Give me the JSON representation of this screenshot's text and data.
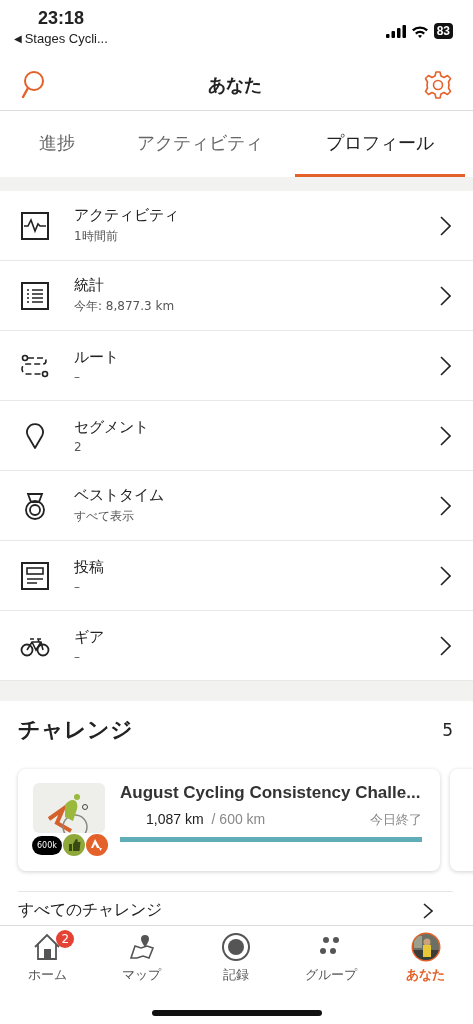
{
  "status_bar": {
    "time": "23:18",
    "back_arrow": "◀",
    "back_label": "Stages Cycli...",
    "battery": "83"
  },
  "header": {
    "title": "あなた"
  },
  "tabs": [
    {
      "label": "進捗",
      "selected": false
    },
    {
      "label": "アクティビティ",
      "selected": false
    },
    {
      "label": "プロフィール",
      "selected": true
    }
  ],
  "menu": [
    {
      "title": "アクティビティ",
      "subtitle": "1時間前"
    },
    {
      "title": "統計",
      "subtitle": "今年: 8,877.3 km"
    },
    {
      "title": "ルート",
      "subtitle": "–"
    },
    {
      "title": "セグメント",
      "subtitle": "2"
    },
    {
      "title": "ベストタイム",
      "subtitle": "すべて表示"
    },
    {
      "title": "投稿",
      "subtitle": "–"
    },
    {
      "title": "ギア",
      "subtitle": "–"
    }
  ],
  "challenges": {
    "title": "チャレンジ",
    "count": "5",
    "cards": [
      {
        "title": "August Cycling Consistency Challe...",
        "badge": "600k",
        "progress": "1,087 km",
        "goal": "/ 600 km",
        "status": "今日終了",
        "level": 1
      }
    ],
    "all_link": "すべてのチャレンジ"
  },
  "bottom_nav": [
    {
      "label": "ホーム",
      "selected": false,
      "badge": "2"
    },
    {
      "label": "マップ",
      "selected": false
    },
    {
      "label": "記録",
      "selected": false
    },
    {
      "label": "グループ",
      "selected": false
    },
    {
      "label": "あなた",
      "selected": true
    }
  ]
}
